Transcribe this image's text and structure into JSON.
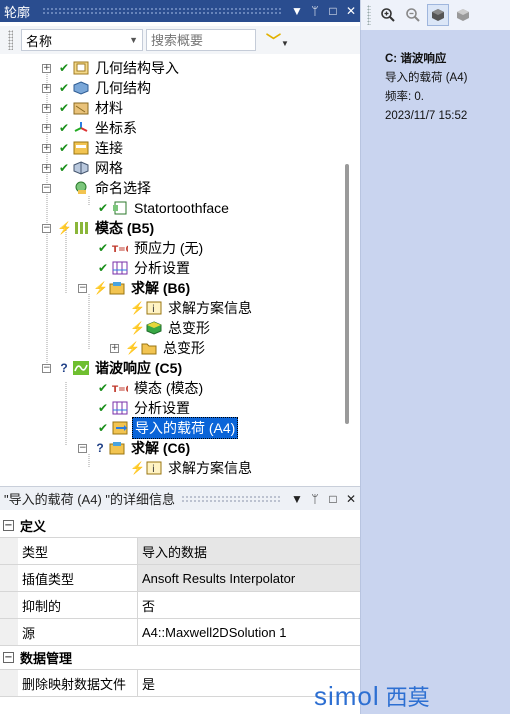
{
  "outline": {
    "title": "轮廓",
    "buttons": [
      "▼",
      "ᛘ",
      "□",
      "✕"
    ]
  },
  "right_toolbar": {
    "buttons": [
      "zoom-in",
      "zoom-out",
      "cube-solid",
      "cube-view"
    ]
  },
  "info": {
    "line1": "C: 谐波响应",
    "line2": "导入的载荷 (A4)",
    "line3": "频率: 0.",
    "line4": "2023/11/7 15:52"
  },
  "filter": {
    "select_value": "名称",
    "search_placeholder": "搜索概要"
  },
  "tree": {
    "items": [
      {
        "label": "几何结构导入"
      },
      {
        "label": "几何结构"
      },
      {
        "label": "材料"
      },
      {
        "label": "坐标系"
      },
      {
        "label": "连接"
      },
      {
        "label": "网格"
      },
      {
        "label": "命名选择"
      },
      {
        "label": "Statortoothface"
      },
      {
        "label": "模态 (B5)"
      },
      {
        "label": "预应力 (无)"
      },
      {
        "label": "分析设置"
      },
      {
        "label": "求解 (B6)"
      },
      {
        "label": "求解方案信息"
      },
      {
        "label": "总变形"
      },
      {
        "label": "总变形"
      },
      {
        "label": "谐波响应 (C5)"
      },
      {
        "label": "模态 (模态)"
      },
      {
        "label": "分析设置"
      },
      {
        "label": "导入的载荷 (A4)"
      },
      {
        "label": "求解 (C6)"
      },
      {
        "label": "求解方案信息"
      }
    ]
  },
  "details": {
    "title": "\"导入的载荷 (A4) \"的详细信息",
    "groups": [
      {
        "label": "定义",
        "rows": [
          {
            "key": "类型",
            "value": "导入的数据"
          },
          {
            "key": "插值类型",
            "value": "Ansoft Results Interpolator"
          },
          {
            "key": "抑制的",
            "value": "否"
          },
          {
            "key": "源",
            "value": "A4::Maxwell2DSolution 1"
          }
        ]
      },
      {
        "label": "数据管理",
        "rows": [
          {
            "key": "删除映射数据文件",
            "value": "是"
          }
        ]
      }
    ]
  },
  "watermark": {
    "text1": "simol",
    "text2": "西莫"
  },
  "colors": {
    "titlebar": "#2a4d8f",
    "info_panel": "#c9d4ef",
    "selection": "#0a64d8",
    "ok_check": "#1a8f1a",
    "watermark": "#2d6fd2"
  }
}
